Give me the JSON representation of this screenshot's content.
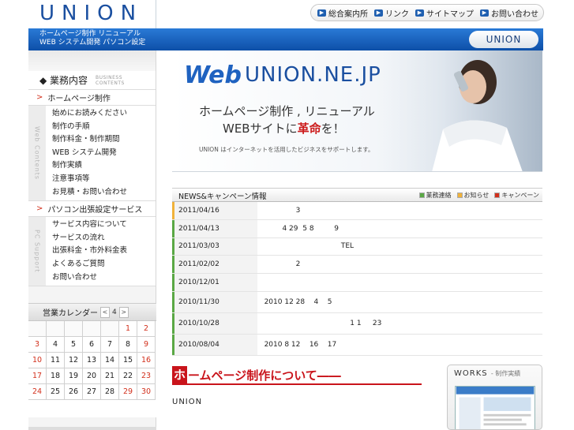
{
  "header": {
    "logo": "UNION",
    "tagline_line1": "ホームページ制作 リニューアル",
    "tagline_line2": "WEB システム開発 パソコン設定",
    "badge": "UNION",
    "links": [
      "総合案内所",
      "リンク",
      "サイトマップ",
      "お問い合わせ"
    ]
  },
  "sidebar": {
    "business_title": "◆ 業務内容",
    "business_sub_1": "BUSINESS",
    "business_sub_2": "CONTENTS",
    "section1_title": "ホームページ制作",
    "section1_side": "Web Contents",
    "section1_items": [
      "始めにお読みください",
      "制作の手順",
      "制作料金・制作期間",
      "WEB システム開発",
      "制作実績",
      "注意事項等",
      "お見積・お問い合わせ"
    ],
    "section2_title": "パソコン出張設定サービス",
    "section2_side": "PC Support",
    "section2_items": [
      "サービス内容について",
      "サービスの流れ",
      "出張料金・市外料金表",
      "よくあるご質問",
      "お問い合わせ"
    ]
  },
  "calendar": {
    "title": "営業カレンダー",
    "prev": "<",
    "month": "4",
    "next": ">",
    "rows": [
      [
        "",
        "",
        "",
        "",
        "",
        "1",
        "2"
      ],
      [
        "3",
        "4",
        "5",
        "6",
        "7",
        "8",
        "9"
      ],
      [
        "10",
        "11",
        "12",
        "13",
        "14",
        "15",
        "16"
      ],
      [
        "17",
        "18",
        "19",
        "20",
        "21",
        "22",
        "23"
      ],
      [
        "24",
        "25",
        "26",
        "27",
        "28",
        "29",
        "30"
      ]
    ],
    "red_days": [
      "1",
      "2",
      "3",
      "9",
      "10",
      "16",
      "17",
      "23",
      "24",
      "29",
      "30"
    ]
  },
  "hero": {
    "web_logo": "Web",
    "domain": "UNION.NE.JP",
    "line1": "ホームページ制作 , リニューアル",
    "line2_prefix": "WEBサイトに",
    "line2_red": "革命",
    "line2_suffix": "を！",
    "small": "UNION はインターネットを活用したビジネスをサポートします。"
  },
  "news": {
    "title": "NEWS&キャンペーン情報",
    "legend": [
      "業務連絡",
      "お知らせ",
      "キャンペーン"
    ],
    "legend_colors": [
      "#5aa845",
      "#f0b23a",
      "#d2301c"
    ],
    "items": [
      {
        "date": "2011/04/16",
        "text": "                 3",
        "color": "#f0b23a"
      },
      {
        "date": "2011/04/13",
        "text": "           4 29  5 8         9",
        "color": "#5aa845"
      },
      {
        "date": "2011/03/03",
        "text": "                                     TEL",
        "color": "#5aa845"
      },
      {
        "date": "2011/02/02",
        "text": "                 2",
        "color": "#5aa845"
      },
      {
        "date": "2010/12/01",
        "text": "",
        "color": "#5aa845"
      },
      {
        "date": "2010/11/30",
        "text": "   2010 12 28    4    5",
        "color": "#5aa845"
      },
      {
        "date": "2010/10/28",
        "text": "                                         1 1     23",
        "color": "#5aa845"
      },
      {
        "date": "2010/08/04",
        "text": "   2010 8 12    16    17",
        "color": "#5aa845"
      }
    ]
  },
  "homepage_section": {
    "title_char": "ホ",
    "title_rest": "ームページ制作について――",
    "body": "UNION"
  },
  "works": {
    "title": "WORKS",
    "sub": "- 制作実績"
  }
}
